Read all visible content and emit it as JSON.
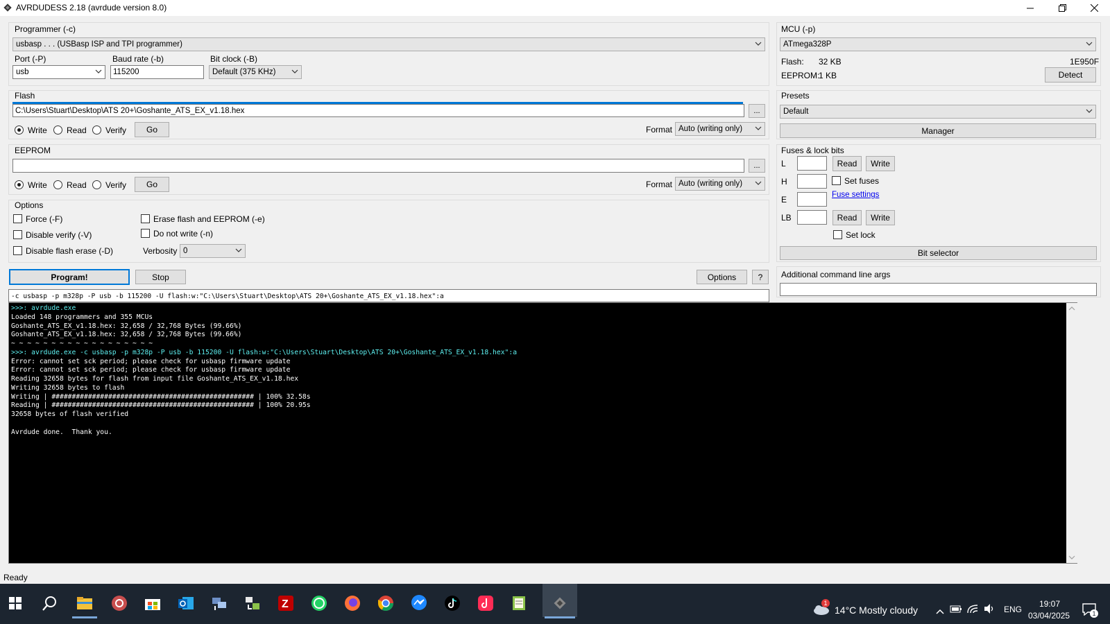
{
  "window": {
    "title": "AVRDUDESS 2.18 (avrdude version 8.0)"
  },
  "programmer": {
    "label": "Programmer (-c)",
    "value": "usbasp . . . (USBasp ISP and TPI programmer)",
    "port_label": "Port (-P)",
    "port_value": "usb",
    "baud_label": "Baud rate (-b)",
    "baud_value": "115200",
    "bitclock_label": "Bit clock (-B)",
    "bitclock_value": "Default (375 KHz)"
  },
  "mcu": {
    "label": "MCU (-p)",
    "value": "ATmega328P",
    "flash_label": "Flash:",
    "flash_value": "32 KB",
    "signature": "1E950F",
    "eeprom_label": "EEPROM:",
    "eeprom_value": "1 KB",
    "detect_label": "Detect"
  },
  "flash": {
    "label": "Flash",
    "file": "C:\\Users\\Stuart\\Desktop\\ATS 20+\\Goshante_ATS_EX_v1.18.hex",
    "browse": "...",
    "write": "Write",
    "read": "Read",
    "verify": "Verify",
    "go": "Go",
    "format_label": "Format",
    "format_value": "Auto (writing only)"
  },
  "eeprom": {
    "label": "EEPROM",
    "file": "",
    "browse": "...",
    "write": "Write",
    "read": "Read",
    "verify": "Verify",
    "go": "Go",
    "format_label": "Format",
    "format_value": "Auto (writing only)"
  },
  "presets": {
    "label": "Presets",
    "value": "Default",
    "manager": "Manager"
  },
  "fuses": {
    "label": "Fuses & lock bits",
    "l": "L",
    "h": "H",
    "e": "E",
    "lb": "LB",
    "read": "Read",
    "write": "Write",
    "set_fuses": "Set fuses",
    "fuse_settings": "Fuse settings",
    "set_lock": "Set lock",
    "bit_selector": "Bit selector"
  },
  "options": {
    "label": "Options",
    "force": "Force (-F)",
    "disable_verify": "Disable verify (-V)",
    "disable_flash_erase": "Disable flash erase (-D)",
    "erase": "Erase flash and EEPROM (-e)",
    "do_not_write": "Do not write (-n)",
    "verbosity_label": "Verbosity",
    "verbosity_value": "0"
  },
  "actions": {
    "program": "Program!",
    "stop": "Stop",
    "options": "Options",
    "help": "?"
  },
  "additional_args": {
    "label": "Additional command line args",
    "value": ""
  },
  "command_line": "-c usbasp -p m328p -P usb -b 115200 -U flash:w:\"C:\\Users\\Stuart\\Desktop\\ATS 20+\\Goshante_ATS_EX_v1.18.hex\":a",
  "console": {
    "lines": [
      {
        "text": ">>>: avrdude.exe",
        "color": "cyan"
      },
      {
        "text": "Loaded 148 programmers and 355 MCUs",
        "color": "white"
      },
      {
        "text": "Goshante_ATS_EX_v1.18.hex: 32,658 / 32,768 Bytes (99.66%)",
        "color": "white"
      },
      {
        "text": "Goshante_ATS_EX_v1.18.hex: 32,658 / 32,768 Bytes (99.66%)",
        "color": "white"
      },
      {
        "text": "~ ~ ~ ~ ~ ~ ~ ~ ~ ~ ~ ~ ~ ~ ~ ~ ~ ~",
        "color": "white"
      },
      {
        "text": ">>>: avrdude.exe -c usbasp -p m328p -P usb -b 115200 -U flash:w:\"C:\\Users\\Stuart\\Desktop\\ATS 20+\\Goshante_ATS_EX_v1.18.hex\":a",
        "color": "cyan"
      },
      {
        "text": "Error: cannot set sck period; please check for usbasp firmware update",
        "color": "white"
      },
      {
        "text": "Error: cannot set sck period; please check for usbasp firmware update",
        "color": "white"
      },
      {
        "text": "Reading 32658 bytes for flash from input file Goshante_ATS_EX_v1.18.hex",
        "color": "white"
      },
      {
        "text": "Writing 32658 bytes to flash",
        "color": "white"
      },
      {
        "text": "Writing | ################################################## | 100% 32.58s",
        "color": "white"
      },
      {
        "text": "Reading | ################################################## | 100% 20.95s",
        "color": "white"
      },
      {
        "text": "32658 bytes of flash verified",
        "color": "white"
      },
      {
        "text": "",
        "color": "white"
      },
      {
        "text": "Avrdude done.  Thank you.",
        "color": "white"
      }
    ]
  },
  "status": "Ready",
  "taskbar": {
    "weather": "14°C  Mostly cloudy",
    "weather_badge": "1",
    "lang": "ENG",
    "time": "19:07",
    "date": "03/04/2025",
    "notif_count": "1",
    "icons": [
      "windows-start-icon",
      "search-icon",
      "file-explorer-icon",
      "app-icon",
      "store-icon",
      "outlook-icon",
      "network-app-icon",
      "sync-app-icon",
      "filezilla-icon",
      "whatsapp-icon",
      "firefox-icon",
      "chrome-icon",
      "messenger-icon",
      "tiktok-icon",
      "tiktok-studio-icon",
      "notepad-icon",
      "avrdudess-icon"
    ]
  },
  "colors": {
    "accent": "#0078d7",
    "console_bg": "#000000",
    "console_cyan": "#5ef0f0",
    "taskbar": "#1c2530"
  }
}
